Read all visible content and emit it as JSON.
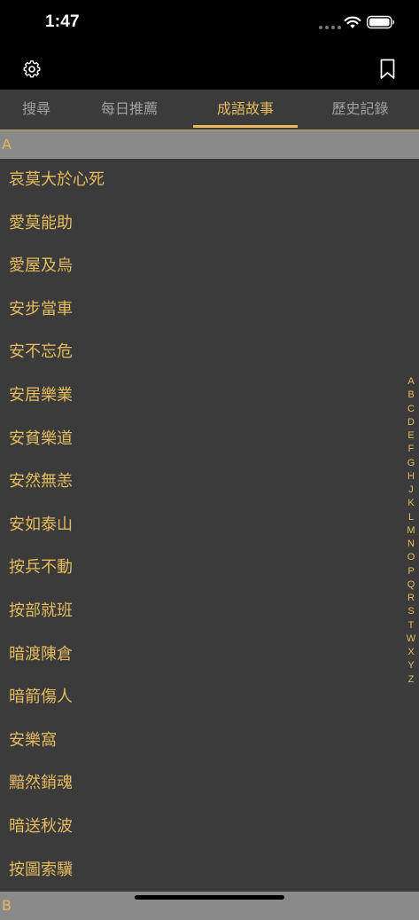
{
  "status": {
    "time": "1:47"
  },
  "tabs": [
    {
      "label": "搜尋"
    },
    {
      "label": "每日推薦"
    },
    {
      "label": "成語故事"
    },
    {
      "label": "歷史記錄"
    }
  ],
  "sections": [
    {
      "letter": "A",
      "items": [
        "哀莫大於心死",
        "愛莫能助",
        "愛屋及烏",
        "安步當車",
        "安不忘危",
        "安居樂業",
        "安貧樂道",
        "安然無恙",
        "安如泰山",
        "按兵不動",
        "按部就班",
        "暗渡陳倉",
        "暗箭傷人",
        "安樂窩",
        "黯然銷魂",
        "暗送秋波",
        "按圖索驥"
      ]
    },
    {
      "letter": "B"
    }
  ],
  "index_letters": [
    "A",
    "B",
    "C",
    "D",
    "E",
    "F",
    "G",
    "H",
    "J",
    "K",
    "L",
    "M",
    "N",
    "O",
    "P",
    "Q",
    "R",
    "S",
    "T",
    "W",
    "X",
    "Y",
    "Z"
  ],
  "colors": {
    "accent": "#e5bb5e",
    "background": "#3b3b3b",
    "section_header": "#8a8a8a",
    "bar": "#000000"
  },
  "icons": {
    "settings": "gear-icon",
    "bookmark": "bookmark-icon"
  }
}
